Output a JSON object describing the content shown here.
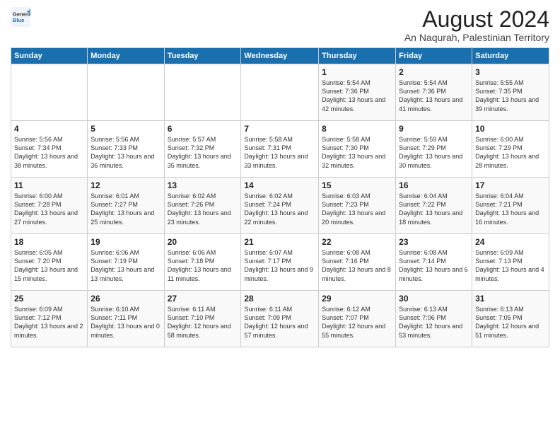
{
  "logo": {
    "general": "General",
    "blue": "Blue"
  },
  "title": "August 2024",
  "subtitle": "An Naqurah, Palestinian Territory",
  "weekdays": [
    "Sunday",
    "Monday",
    "Tuesday",
    "Wednesday",
    "Thursday",
    "Friday",
    "Saturday"
  ],
  "weeks": [
    [
      {
        "day": "",
        "detail": ""
      },
      {
        "day": "",
        "detail": ""
      },
      {
        "day": "",
        "detail": ""
      },
      {
        "day": "",
        "detail": ""
      },
      {
        "day": "1",
        "detail": "Sunrise: 5:54 AM\nSunset: 7:36 PM\nDaylight: 13 hours\nand 42 minutes."
      },
      {
        "day": "2",
        "detail": "Sunrise: 5:54 AM\nSunset: 7:36 PM\nDaylight: 13 hours\nand 41 minutes."
      },
      {
        "day": "3",
        "detail": "Sunrise: 5:55 AM\nSunset: 7:35 PM\nDaylight: 13 hours\nand 39 minutes."
      }
    ],
    [
      {
        "day": "4",
        "detail": "Sunrise: 5:56 AM\nSunset: 7:34 PM\nDaylight: 13 hours\nand 38 minutes."
      },
      {
        "day": "5",
        "detail": "Sunrise: 5:56 AM\nSunset: 7:33 PM\nDaylight: 13 hours\nand 36 minutes."
      },
      {
        "day": "6",
        "detail": "Sunrise: 5:57 AM\nSunset: 7:32 PM\nDaylight: 13 hours\nand 35 minutes."
      },
      {
        "day": "7",
        "detail": "Sunrise: 5:58 AM\nSunset: 7:31 PM\nDaylight: 13 hours\nand 33 minutes."
      },
      {
        "day": "8",
        "detail": "Sunrise: 5:58 AM\nSunset: 7:30 PM\nDaylight: 13 hours\nand 32 minutes."
      },
      {
        "day": "9",
        "detail": "Sunrise: 5:59 AM\nSunset: 7:29 PM\nDaylight: 13 hours\nand 30 minutes."
      },
      {
        "day": "10",
        "detail": "Sunrise: 6:00 AM\nSunset: 7:29 PM\nDaylight: 13 hours\nand 28 minutes."
      }
    ],
    [
      {
        "day": "11",
        "detail": "Sunrise: 6:00 AM\nSunset: 7:28 PM\nDaylight: 13 hours\nand 27 minutes."
      },
      {
        "day": "12",
        "detail": "Sunrise: 6:01 AM\nSunset: 7:27 PM\nDaylight: 13 hours\nand 25 minutes."
      },
      {
        "day": "13",
        "detail": "Sunrise: 6:02 AM\nSunset: 7:26 PM\nDaylight: 13 hours\nand 23 minutes."
      },
      {
        "day": "14",
        "detail": "Sunrise: 6:02 AM\nSunset: 7:24 PM\nDaylight: 13 hours\nand 22 minutes."
      },
      {
        "day": "15",
        "detail": "Sunrise: 6:03 AM\nSunset: 7:23 PM\nDaylight: 13 hours\nand 20 minutes."
      },
      {
        "day": "16",
        "detail": "Sunrise: 6:04 AM\nSunset: 7:22 PM\nDaylight: 13 hours\nand 18 minutes."
      },
      {
        "day": "17",
        "detail": "Sunrise: 6:04 AM\nSunset: 7:21 PM\nDaylight: 13 hours\nand 16 minutes."
      }
    ],
    [
      {
        "day": "18",
        "detail": "Sunrise: 6:05 AM\nSunset: 7:20 PM\nDaylight: 13 hours\nand 15 minutes."
      },
      {
        "day": "19",
        "detail": "Sunrise: 6:06 AM\nSunset: 7:19 PM\nDaylight: 13 hours\nand 13 minutes."
      },
      {
        "day": "20",
        "detail": "Sunrise: 6:06 AM\nSunset: 7:18 PM\nDaylight: 13 hours\nand 11 minutes."
      },
      {
        "day": "21",
        "detail": "Sunrise: 6:07 AM\nSunset: 7:17 PM\nDaylight: 13 hours\nand 9 minutes."
      },
      {
        "day": "22",
        "detail": "Sunrise: 6:08 AM\nSunset: 7:16 PM\nDaylight: 13 hours\nand 8 minutes."
      },
      {
        "day": "23",
        "detail": "Sunrise: 6:08 AM\nSunset: 7:14 PM\nDaylight: 13 hours\nand 6 minutes."
      },
      {
        "day": "24",
        "detail": "Sunrise: 6:09 AM\nSunset: 7:13 PM\nDaylight: 13 hours\nand 4 minutes."
      }
    ],
    [
      {
        "day": "25",
        "detail": "Sunrise: 6:09 AM\nSunset: 7:12 PM\nDaylight: 13 hours\nand 2 minutes."
      },
      {
        "day": "26",
        "detail": "Sunrise: 6:10 AM\nSunset: 7:11 PM\nDaylight: 13 hours\nand 0 minutes."
      },
      {
        "day": "27",
        "detail": "Sunrise: 6:11 AM\nSunset: 7:10 PM\nDaylight: 12 hours\nand 58 minutes."
      },
      {
        "day": "28",
        "detail": "Sunrise: 6:11 AM\nSunset: 7:09 PM\nDaylight: 12 hours\nand 57 minutes."
      },
      {
        "day": "29",
        "detail": "Sunrise: 6:12 AM\nSunset: 7:07 PM\nDaylight: 12 hours\nand 55 minutes."
      },
      {
        "day": "30",
        "detail": "Sunrise: 6:13 AM\nSunset: 7:06 PM\nDaylight: 12 hours\nand 53 minutes."
      },
      {
        "day": "31",
        "detail": "Sunrise: 6:13 AM\nSunset: 7:05 PM\nDaylight: 12 hours\nand 51 minutes."
      }
    ]
  ]
}
